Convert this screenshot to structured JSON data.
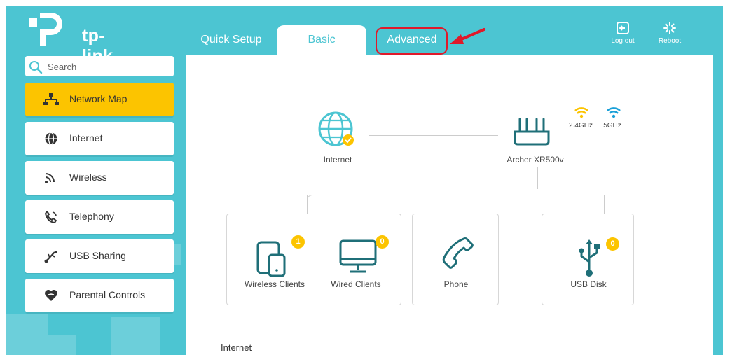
{
  "brand": {
    "name": "tp-link"
  },
  "tabs": [
    {
      "label": "Quick Setup",
      "active": false
    },
    {
      "label": "Basic",
      "active": true
    },
    {
      "label": "Advanced",
      "active": false
    }
  ],
  "top_actions": {
    "logout": "Log out",
    "reboot": "Reboot"
  },
  "search": {
    "placeholder": "Search"
  },
  "sidebar": {
    "items": [
      {
        "label": "Network Map",
        "icon": "network-map-icon",
        "active": true
      },
      {
        "label": "Internet",
        "icon": "globe-icon",
        "active": false
      },
      {
        "label": "Wireless",
        "icon": "wireless-icon",
        "active": false
      },
      {
        "label": "Telephony",
        "icon": "phone-icon",
        "active": false
      },
      {
        "label": "USB Sharing",
        "icon": "usb-icon",
        "active": false
      },
      {
        "label": "Parental Controls",
        "icon": "heart-icon",
        "active": false
      }
    ]
  },
  "network_map": {
    "internet_label": "Internet",
    "router_label": "Archer XR500v",
    "band_24": "2.4GHz",
    "band_5": "5GHz",
    "wireless_clients": {
      "label": "Wireless Clients",
      "count": "1"
    },
    "wired_clients": {
      "label": "Wired Clients",
      "count": "0"
    },
    "phone": {
      "label": "Phone"
    },
    "usb_disk": {
      "label": "USB Disk",
      "count": "0"
    },
    "section_title": "Internet"
  },
  "colors": {
    "teal": "#4cc5d2",
    "yellow": "#fcc400",
    "highlight_red": "#e0192a"
  }
}
